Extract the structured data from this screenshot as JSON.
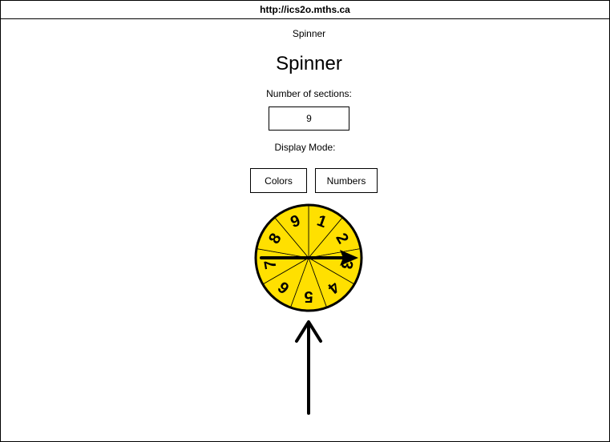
{
  "browser": {
    "url": "http://ics2o.mths.ca"
  },
  "page": {
    "doc_title": "Spinner",
    "heading": "Spinner",
    "sections_label": "Number of sections:",
    "sections_value": "9",
    "mode_label": "Display Mode:",
    "buttons": {
      "colors": "Colors",
      "numbers": "Numbers"
    }
  },
  "spinner": {
    "fill_color": "#ffe000",
    "stroke_color": "#000000",
    "sections": [
      "1",
      "2",
      "3",
      "4",
      "5",
      "6",
      "7",
      "8",
      "9"
    ],
    "needle_icon": "arrow-right-icon"
  },
  "pointer": {
    "icon": "arrow-up-icon"
  }
}
